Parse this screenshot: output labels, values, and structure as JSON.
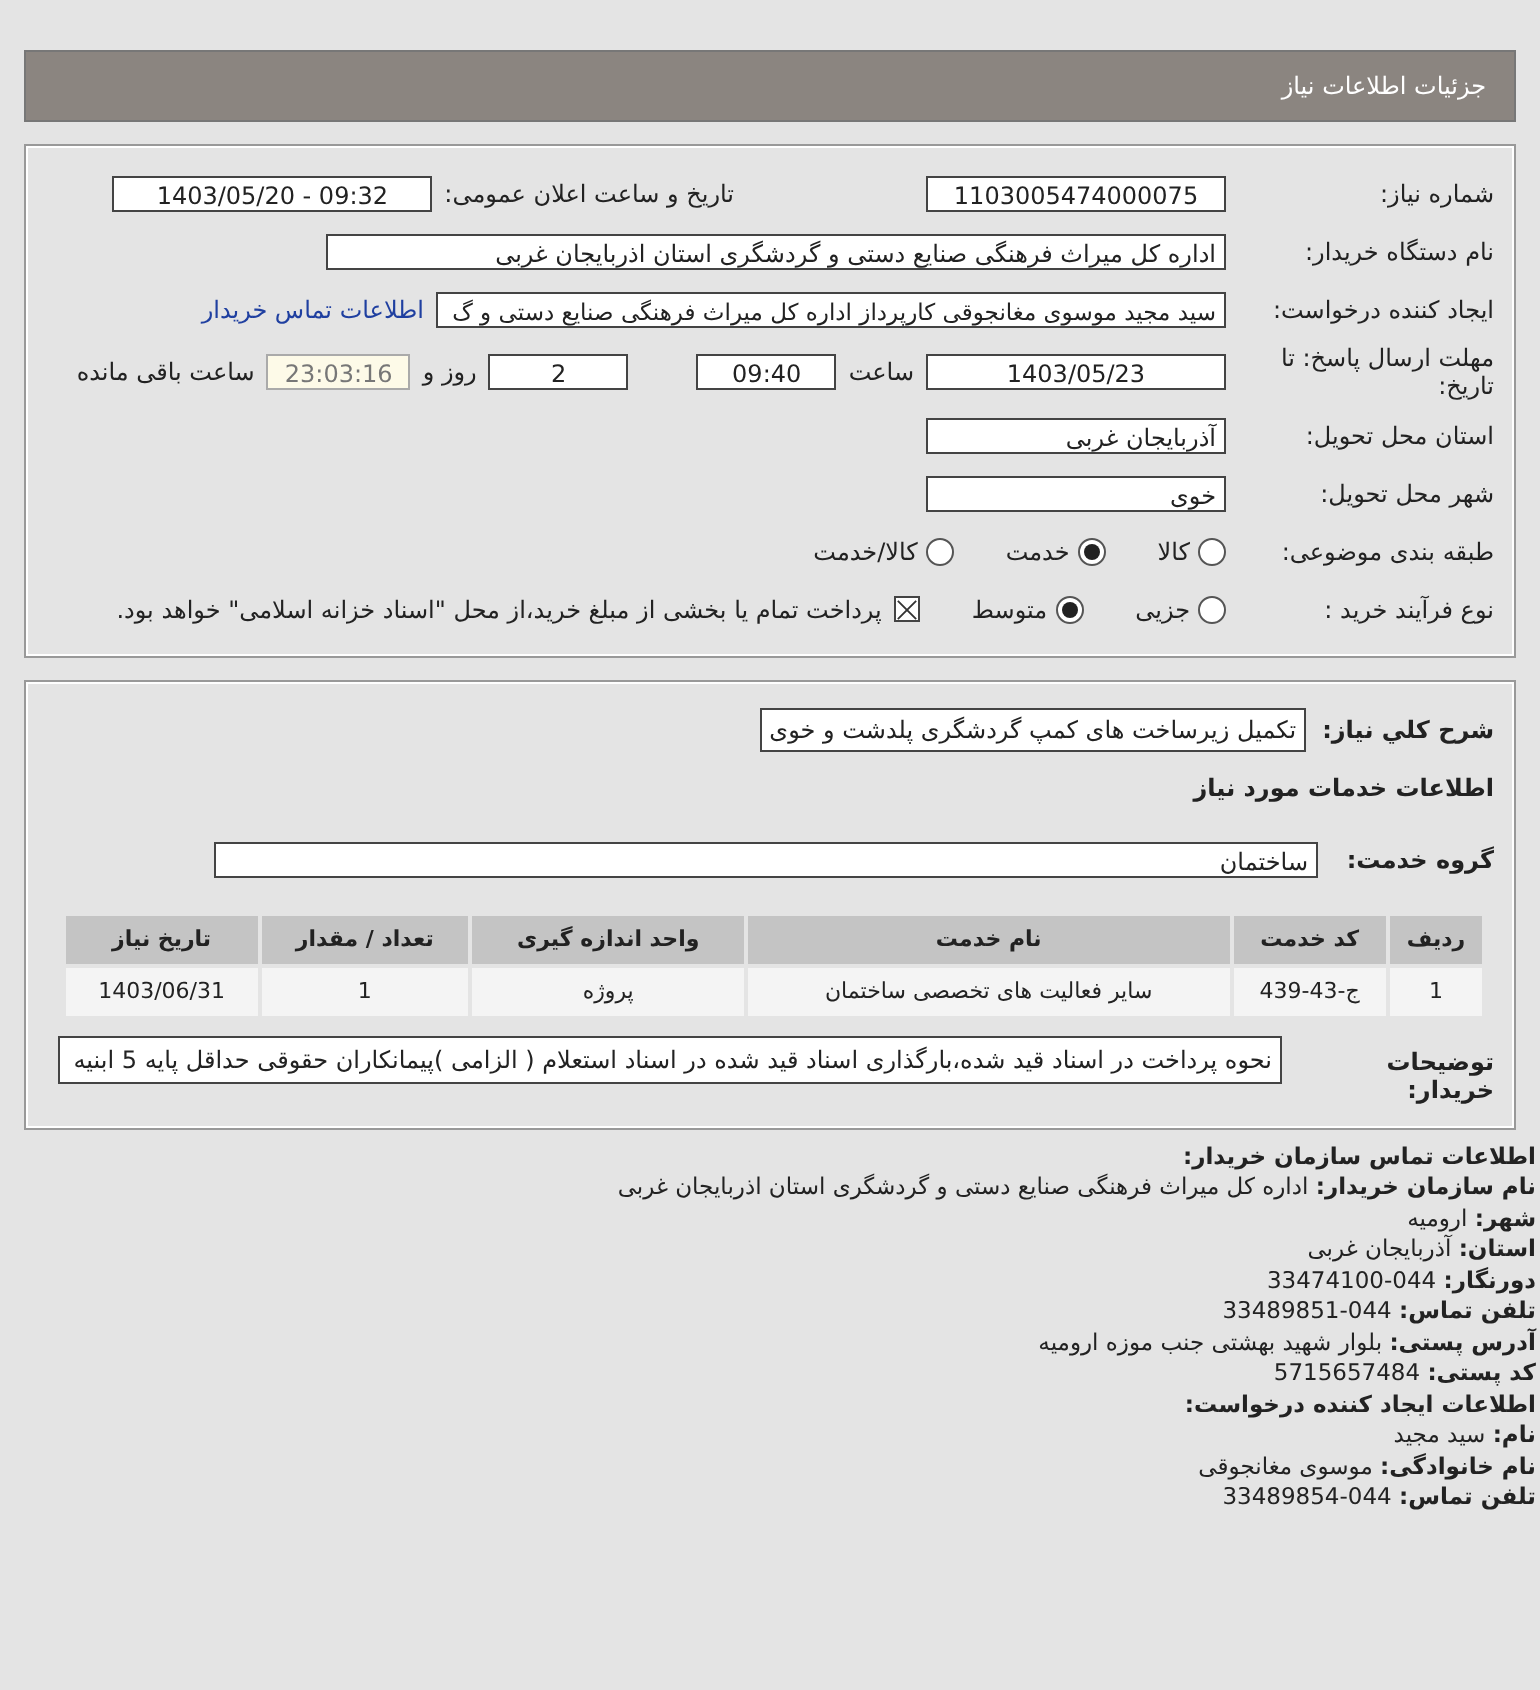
{
  "header": {
    "title": "جزئیات اطلاعات نیاز"
  },
  "need_number": {
    "label": "شماره نیاز:",
    "value": "1103005474000075"
  },
  "announce": {
    "label": "تاریخ و ساعت اعلان عمومی:",
    "value": "1403/05/20 - 09:32"
  },
  "buyer": {
    "label": "نام دستگاه خریدار:",
    "value": "اداره کل میراث فرهنگی  صنایع دستی و گردشگری استان اذربایجان غربی"
  },
  "requester": {
    "label": "ایجاد کننده درخواست:",
    "value": "سید مجید موسوی مغانجوقی کارپرداز اداره کل میراث فرهنگی  صنایع دستی و گ",
    "link": "اطلاعات تماس خریدار"
  },
  "deadline": {
    "label": "مهلت ارسال پاسخ: تا تاریخ:",
    "date": "1403/05/23",
    "time_label": "ساعت",
    "time": "09:40",
    "days": "2",
    "days_label": "روز و",
    "remaining": "23:03:16",
    "remaining_label": "ساعت باقی مانده"
  },
  "province": {
    "label": "استان محل تحویل:",
    "value": "آذربایجان غربی"
  },
  "city": {
    "label": "شهر محل تحویل:",
    "value": "خوی"
  },
  "category": {
    "label": "طبقه بندی موضوعی:",
    "options": [
      {
        "label": "کالا",
        "selected": false
      },
      {
        "label": "خدمت",
        "selected": true
      },
      {
        "label": "کالا/خدمت",
        "selected": false
      }
    ]
  },
  "process": {
    "label": "نوع فرآیند خرید :",
    "options": [
      {
        "label": "جزیی",
        "selected": false
      },
      {
        "label": "متوسط",
        "selected": true
      }
    ],
    "payment": {
      "checked": true,
      "label": "پرداخت تمام یا بخشی از مبلغ خرید،از محل \"اسناد خزانه اسلامی\" خواهد بود."
    }
  },
  "summary": {
    "label": "شرح کلي نياز:",
    "value": "تکمیل زیرساخت های کمپ گردشگری پلدشت و خوی"
  },
  "services_title": "اطلاعات خدمات مورد نیاز",
  "service_group": {
    "label": "گروه خدمت:",
    "value": "ساختمان"
  },
  "table": {
    "columns": [
      "ردیف",
      "کد خدمت",
      "نام خدمت",
      "واحد اندازه گیری",
      "تعداد / مقدار",
      "تاریخ نیاز"
    ],
    "rows": [
      [
        "1",
        "ج-43-439",
        "سایر فعالیت های تخصصی ساختمان",
        "پروژه",
        "1",
        "1403/06/31"
      ]
    ]
  },
  "buyer_notes": {
    "label": "توضیحات خریدار:",
    "value": "نحوه پرداخت در اسناد قید شده،بارگذاری اسناد قید شده در اسناد استعلام ( الزامی )پیمانکاران حقوقی حداقل پایه 5 ابنیه"
  },
  "contact": [
    {
      "kind": "heading",
      "label": "اطلاعات تماس سازمان خریدار:"
    },
    {
      "kind": "field",
      "label": "نام سازمان خریدار:",
      "value": "اداره کل میراث فرهنگی صنایع دستی و گردشگری استان اذربایجان غربی"
    },
    {
      "kind": "field",
      "label": "شهر:",
      "value": "ارومیه"
    },
    {
      "kind": "field",
      "label": "استان:",
      "value": "آذربایجان غربی"
    },
    {
      "kind": "field",
      "label": "دورنگار:",
      "value": "044-33474100"
    },
    {
      "kind": "field",
      "label": "تلفن تماس:",
      "value": "044-33489851"
    },
    {
      "kind": "field",
      "label": "آدرس پستی:",
      "value": "بلوار شهید بهشتی جنب موزه ارومیه"
    },
    {
      "kind": "field",
      "label": "کد پستی:",
      "value": "5715657484"
    },
    {
      "kind": "heading",
      "label": "اطلاعات ایجاد کننده درخواست:"
    },
    {
      "kind": "field",
      "label": "نام:",
      "value": "سید مجید"
    },
    {
      "kind": "field",
      "label": "نام خانوادگی:",
      "value": "موسوی مغانجوقی"
    },
    {
      "kind": "field",
      "label": "تلفن تماس:",
      "value": "044-33489854"
    }
  ]
}
